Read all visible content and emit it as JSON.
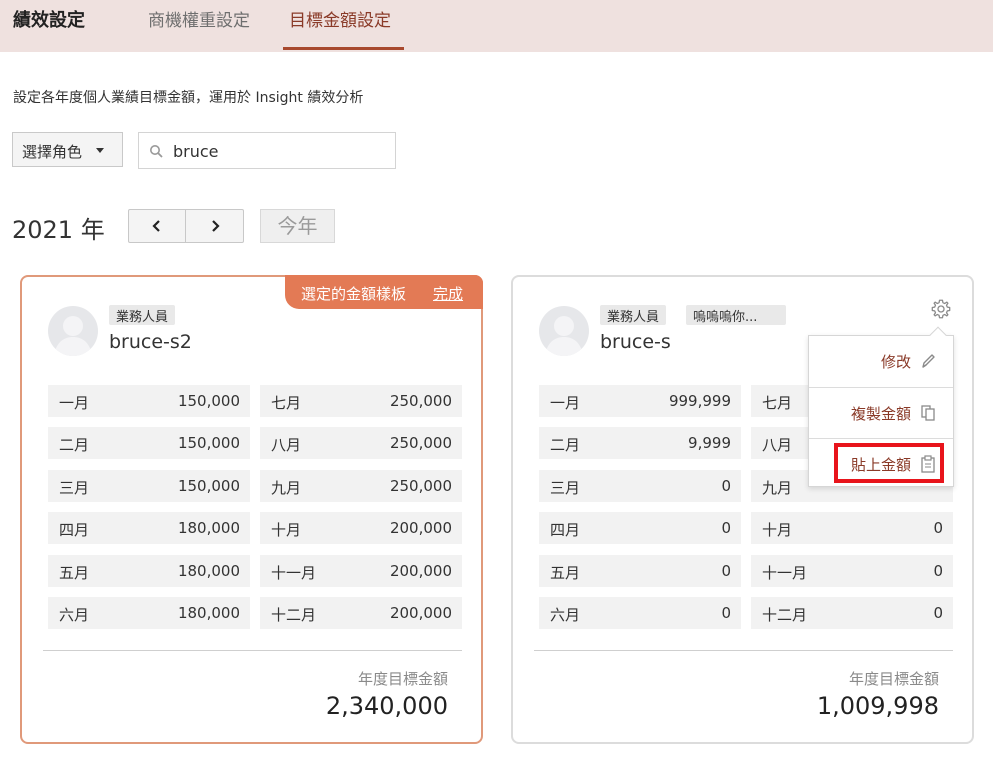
{
  "header": {
    "title": "績效設定",
    "tabs": [
      {
        "label": "商機權重設定",
        "active": false
      },
      {
        "label": "目標金額設定",
        "active": true
      }
    ]
  },
  "description": "設定各年度個人業績目標金額，運用於 Insight 績效分析",
  "filters": {
    "role_select": "選擇角色",
    "search_value": "bruce"
  },
  "year_nav": {
    "year_label": "2021 年",
    "today_label": "今年"
  },
  "colors": {
    "accent": "#a8492e",
    "template_tag": "#e37a55",
    "highlight": "#e8141b",
    "header_bg": "#efe1df"
  },
  "cards": [
    {
      "name": "bruce-s2",
      "badges": [
        "業務人員"
      ],
      "template_tag": {
        "label": "選定的金額樣板",
        "done": "完成"
      },
      "months_left": [
        {
          "month": "一月",
          "value": "150,000"
        },
        {
          "month": "二月",
          "value": "150,000"
        },
        {
          "month": "三月",
          "value": "150,000"
        },
        {
          "month": "四月",
          "value": "180,000"
        },
        {
          "month": "五月",
          "value": "180,000"
        },
        {
          "month": "六月",
          "value": "180,000"
        }
      ],
      "months_right": [
        {
          "month": "七月",
          "value": "250,000"
        },
        {
          "month": "八月",
          "value": "250,000"
        },
        {
          "month": "九月",
          "value": "250,000"
        },
        {
          "month": "十月",
          "value": "200,000"
        },
        {
          "month": "十一月",
          "value": "200,000"
        },
        {
          "month": "十二月",
          "value": "200,000"
        }
      ],
      "annual_label": "年度目標金額",
      "annual_value": "2,340,000"
    },
    {
      "name": "bruce-s",
      "badges": [
        "業務人員",
        "嗚嗚嗚你..."
      ],
      "months_left": [
        {
          "month": "一月",
          "value": "999,999"
        },
        {
          "month": "二月",
          "value": "9,999"
        },
        {
          "month": "三月",
          "value": "0"
        },
        {
          "month": "四月",
          "value": "0"
        },
        {
          "month": "五月",
          "value": "0"
        },
        {
          "month": "六月",
          "value": "0"
        }
      ],
      "months_right": [
        {
          "month": "七月",
          "value": ""
        },
        {
          "month": "八月",
          "value": ""
        },
        {
          "month": "九月",
          "value": ""
        },
        {
          "month": "十月",
          "value": "0"
        },
        {
          "month": "十一月",
          "value": "0"
        },
        {
          "month": "十二月",
          "value": "0"
        }
      ],
      "annual_label": "年度目標金額",
      "annual_value": "1,009,998",
      "menu": {
        "items": [
          {
            "label": "修改",
            "icon": "pencil-icon"
          },
          {
            "label": "複製金額",
            "icon": "copy-icon"
          },
          {
            "label": "貼上金額",
            "icon": "paste-icon",
            "highlighted": true
          }
        ]
      }
    }
  ]
}
